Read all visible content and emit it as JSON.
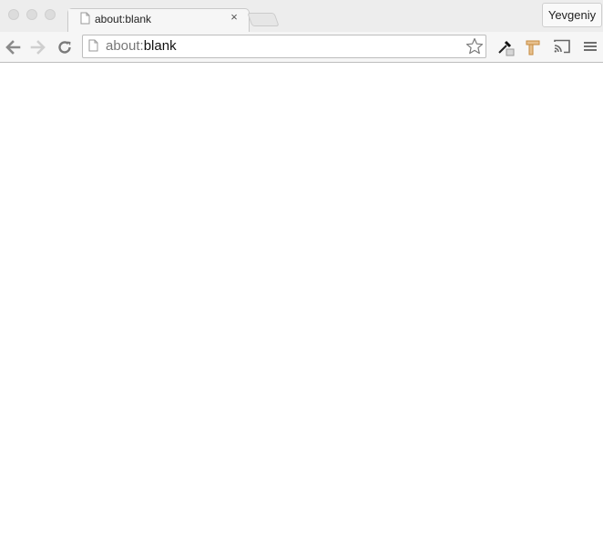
{
  "window": {
    "tab": {
      "title": "about:blank"
    },
    "profile": {
      "name": "Yevgeniy"
    }
  },
  "omnibox": {
    "url_scheme": "about:",
    "url_rest": "blank"
  },
  "icons": {
    "tab_page": "page-icon",
    "tab_close": "close-icon",
    "back": "back-arrow-icon",
    "forward": "forward-arrow-icon",
    "reload": "reload-icon",
    "bookmark": "star-icon",
    "extension_1": "eyedropper-icon",
    "extension_2": "hammer-icon",
    "cast": "cast-icon",
    "menu": "hamburger-menu-icon"
  },
  "colors": {
    "chrome_bg": "#f2f2f2",
    "tab_bg": "#f6f6f6",
    "page_bg": "#ffffff",
    "url_scheme": "#777777",
    "url_text": "#111111"
  }
}
